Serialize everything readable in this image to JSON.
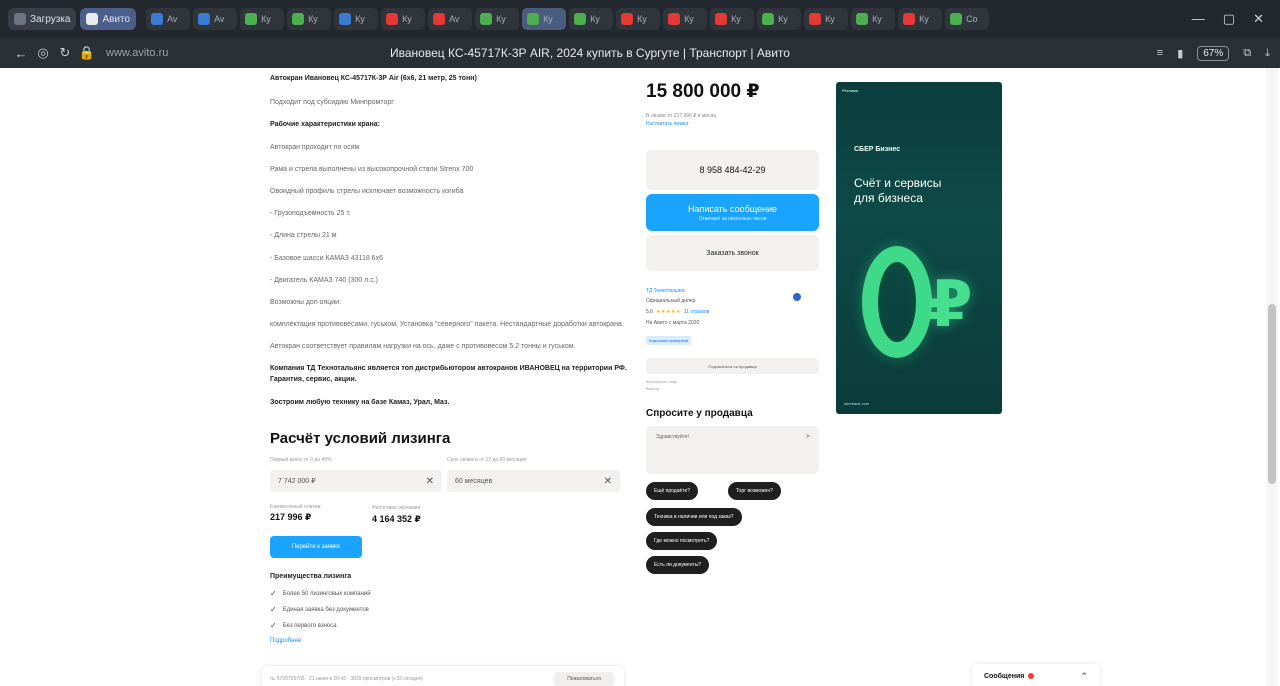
{
  "browser": {
    "tab_label_1": "Загрузка",
    "tab_label_2": "Авито",
    "mini_tabs": [
      "Av",
      "Av",
      "Ку",
      "Ку",
      "Ку",
      "Ку",
      "Av",
      "Ку",
      "Ку",
      "Ку",
      "Ку",
      "Ку",
      "Ку",
      "Ку",
      "Ку",
      "Ку",
      "Ку",
      "Co"
    ],
    "url": "www.avito.ru",
    "title": "Ивановец КС-45717К-3Р AIR, 2024 купить в Сургуте | Транспорт | Авито",
    "zoom": "67%"
  },
  "description": {
    "lines": [
      {
        "text": "Автокран Ивановец КС-45717К-3Р Air (6х6, 21 метр, 25 тонн)",
        "bold": true
      },
      {
        "text": "Подходит под субсидию Минпромторг",
        "bold": false
      },
      {
        "text": "Рабочие характеристики крана:",
        "bold": true
      },
      {
        "text": "Автокран проходит по осям",
        "bold": false
      },
      {
        "text": "Рама и стрела выполнены из высокопрочной стали Strenx 700",
        "bold": false
      },
      {
        "text": "Овоидный профиль стрелы исключает возможность изгиба",
        "bold": false
      },
      {
        "text": "- Грузоподъемность 25 т.",
        "bold": false
      },
      {
        "text": "- Длина стрелы 21 м",
        "bold": false
      },
      {
        "text": "- Базовое шасси КАМАЗ 43118 6х6",
        "bold": false
      },
      {
        "text": "- Двигатель КАМАЗ 740 (300 л.с.)",
        "bold": false
      },
      {
        "text": "Возможны доп опции:",
        "bold": false
      },
      {
        "text": "комплектация противовесами, гуськом, Установка \"северного\" пакета. Нестандартные доработки автокрана.",
        "bold": false
      },
      {
        "text": "Автокран соответствует правилам нагрузки на ось, даже с противовесом 5.2 тонны и гуськом.",
        "bold": false
      },
      {
        "text": "Компания ТД Технотальянс является топ дистрибьютором автокранов ИВАНОВЕЦ на территории РФ. Гарантия, сервис, акции.",
        "bold": true
      },
      {
        "text": "Зостроим любую технику на базе Камаз, Урал, Маз.",
        "bold": true
      }
    ]
  },
  "leasing": {
    "title": "Расчёт условий лизинга",
    "down_label": "Первый взнос от 0 до 49%",
    "term_label": "Срок лизинга от 12 до 60 месяцев",
    "down_value": "7 742 000 ₽",
    "term_value": "60 месяцев",
    "monthly_label": "Ежемесячный платеж",
    "monthly_value": "217 996 ₽",
    "saving_label": "Налоговая экономия",
    "saving_value": "4 164 352 ₽",
    "button": "Перейти к заявке",
    "adv_title": "Преимущества лизинга",
    "advantages": [
      "Более 50 лизинговых компаний",
      "Единая заявка без документов",
      "Без первого взноса"
    ],
    "more": "Подробнее"
  },
  "bottom_card": {
    "text": "№ 5700705705 · 21 июня в 20:43 · 3839 просмотров (+33 сегодня)",
    "button": "Пожаловаться"
  },
  "product": {
    "price": "15 800 000 ₽",
    "price_sub": "В лизинг от 217 996 ₽ в месяц",
    "price_link": "Рассчитать лизинг",
    "phone": "8 958 484-42-29",
    "msg_button": "Написать сообщение",
    "msg_sub": "Отвечает за несколько часов",
    "call_button": "Заказать звонок"
  },
  "seller": {
    "name": "ТД Технотальянс",
    "type": "Официальный дилер",
    "rating": "5,0",
    "stars": "★★★★★",
    "reviews": "11 отзывов",
    "since": "На Авито с марта 2020",
    "badge": "Компания проверена",
    "subscribe": "Подписаться на продавца",
    "meta1": "Контактное лицо",
    "meta2": "Виктор"
  },
  "ask": {
    "title": "Спросите у продавца",
    "placeholder": "Здравствуйте!",
    "chips": [
      "Ещё продаёте?",
      "Торг возможен?",
      "Техника в наличии или под заказ?",
      "Где можно посмотреть?",
      "Есть ли документы?"
    ]
  },
  "ad": {
    "mark": "Реклама",
    "logo": "СБЕР Бизнес",
    "headline_1": "Счёт и сервисы",
    "headline_2": "для бизнеса",
    "foot": "sberbank.com",
    "symbol": "₽"
  },
  "messages": {
    "label": "Сообщения"
  },
  "icons": {
    "back": "back-arrow-icon",
    "refresh": "refresh-icon",
    "lock": "lock-icon",
    "close": "close-icon",
    "check": "check-icon",
    "chevron": "chevron-up-icon"
  },
  "colors": {
    "accent": "#1aa3ff",
    "ad_bg": "#0b3d3d",
    "ad_green": "#3fd98a"
  }
}
